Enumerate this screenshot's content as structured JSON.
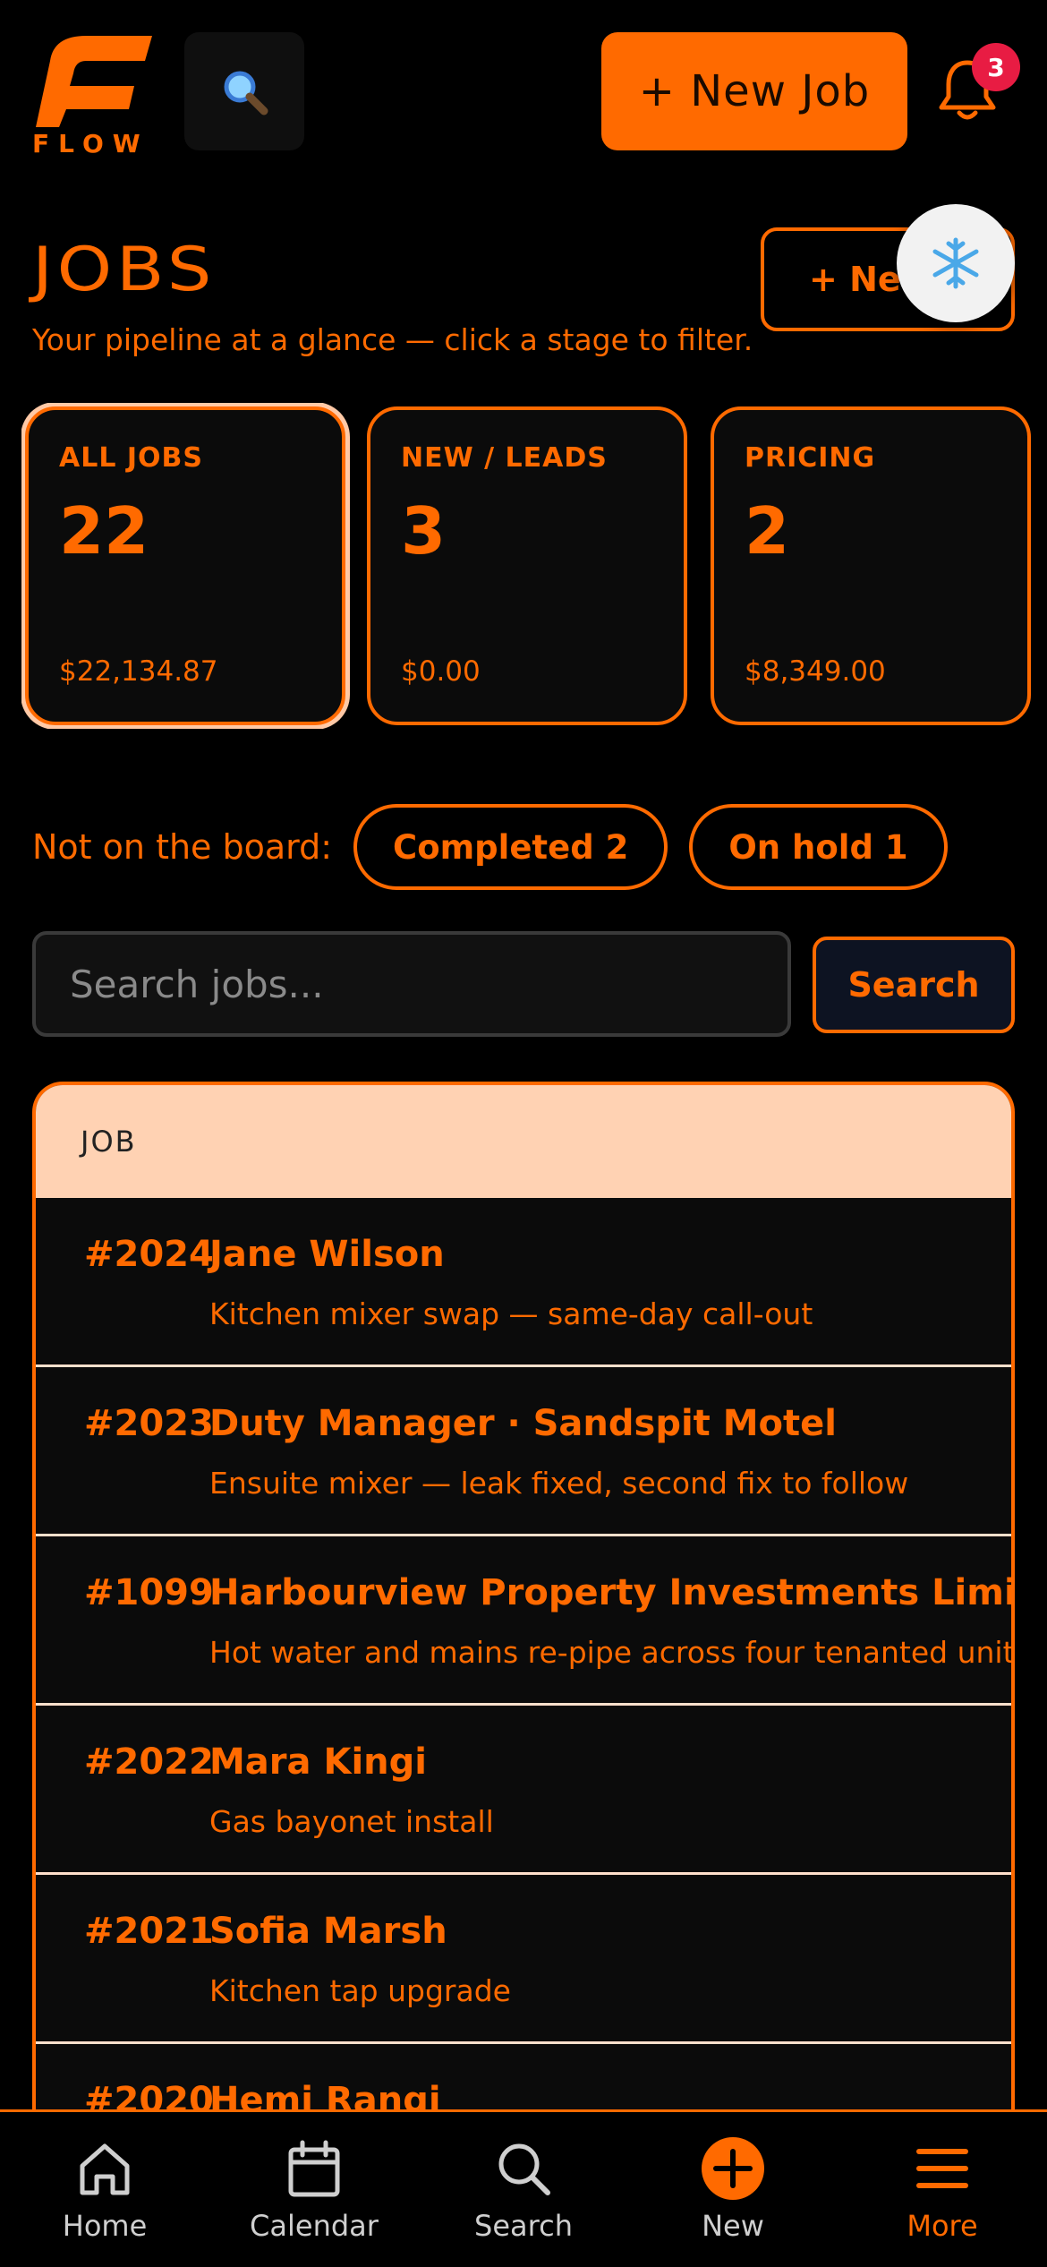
{
  "header": {
    "logo_text": "FLOW",
    "new_job_label": "+ New Job",
    "notification_count": "3",
    "search_icon": "magnifier-emoji-icon",
    "bell_icon": "bell-icon",
    "accent_color": "#ff6a00"
  },
  "page": {
    "title": "JOBS",
    "subtitle": "Your pipeline at a glance — click a stage to filter.",
    "new_button_label": "+ New",
    "snowflake_icon": "snowflake-icon"
  },
  "stages": [
    {
      "label": "ALL JOBS",
      "count": "22",
      "amount": "$22,134.87",
      "active": true
    },
    {
      "label": "NEW / LEADS",
      "count": "3",
      "amount": "$0.00",
      "active": false
    },
    {
      "label": "PRICING",
      "count": "2",
      "amount": "$8,349.00",
      "active": false
    }
  ],
  "not_on_board": {
    "label": "Not on the board:",
    "pills": [
      "Completed 2",
      "On hold 1"
    ]
  },
  "search": {
    "placeholder": "Search jobs...",
    "button_label": "Search"
  },
  "table": {
    "header": "JOB",
    "rows": [
      {
        "number": "#2024",
        "name": "Jane Wilson",
        "description": "Kitchen mixer swap — same-day call-out"
      },
      {
        "number": "#2023",
        "name": "Duty Manager · Sandspit Motel",
        "description": "Ensuite mixer — leak fixed, second fix to follow"
      },
      {
        "number": "#1099",
        "name": "Harbourview Property Investments Limited Partn",
        "description": "Hot water and mains re-pipe across four tenanted units — s"
      },
      {
        "number": "#2022",
        "name": "Mara Kingi",
        "description": "Gas bayonet install"
      },
      {
        "number": "#2021",
        "name": "Sofia Marsh",
        "description": "Kitchen tap upgrade"
      },
      {
        "number": "#2020",
        "name": "Hemi Rangi",
        "description": ""
      }
    ]
  },
  "bottom_nav": [
    {
      "label": "Home",
      "icon": "home-icon"
    },
    {
      "label": "Calendar",
      "icon": "calendar-icon"
    },
    {
      "label": "Search",
      "icon": "search-icon"
    },
    {
      "label": "New",
      "icon": "plus-circle-icon"
    },
    {
      "label": "More",
      "icon": "menu-icon",
      "active": true
    }
  ]
}
